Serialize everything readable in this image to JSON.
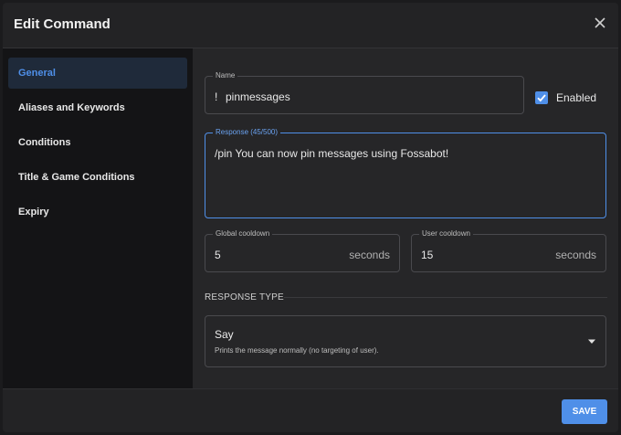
{
  "dialog": {
    "title": "Edit Command"
  },
  "sidebar": {
    "items": [
      {
        "label": "General",
        "active": true
      },
      {
        "label": "Aliases and Keywords",
        "active": false
      },
      {
        "label": "Conditions",
        "active": false
      },
      {
        "label": "Title & Game Conditions",
        "active": false
      },
      {
        "label": "Expiry",
        "active": false
      }
    ]
  },
  "form": {
    "name": {
      "label": "Name",
      "prefix": "!",
      "value": "pinmessages"
    },
    "enabled": {
      "label": "Enabled",
      "checked": true
    },
    "response": {
      "label": "Response (45/500)",
      "value": "/pin You can now pin messages using Fossabot!"
    },
    "global_cooldown": {
      "label": "Global cooldown",
      "value": "5",
      "unit": "seconds"
    },
    "user_cooldown": {
      "label": "User cooldown",
      "value": "15",
      "unit": "seconds"
    },
    "response_type": {
      "section_label": "RESPONSE TYPE",
      "value": "Say",
      "description": "Prints the message normally (no targeting of user)."
    }
  },
  "footer": {
    "save_label": "SAVE"
  },
  "colors": {
    "accent": "#4f8fe8",
    "background": "#262628",
    "sidebar": "#141416"
  },
  "icons": {
    "close": "close-icon",
    "checkbox": "checkmark-icon",
    "caret": "caret-down-icon"
  }
}
